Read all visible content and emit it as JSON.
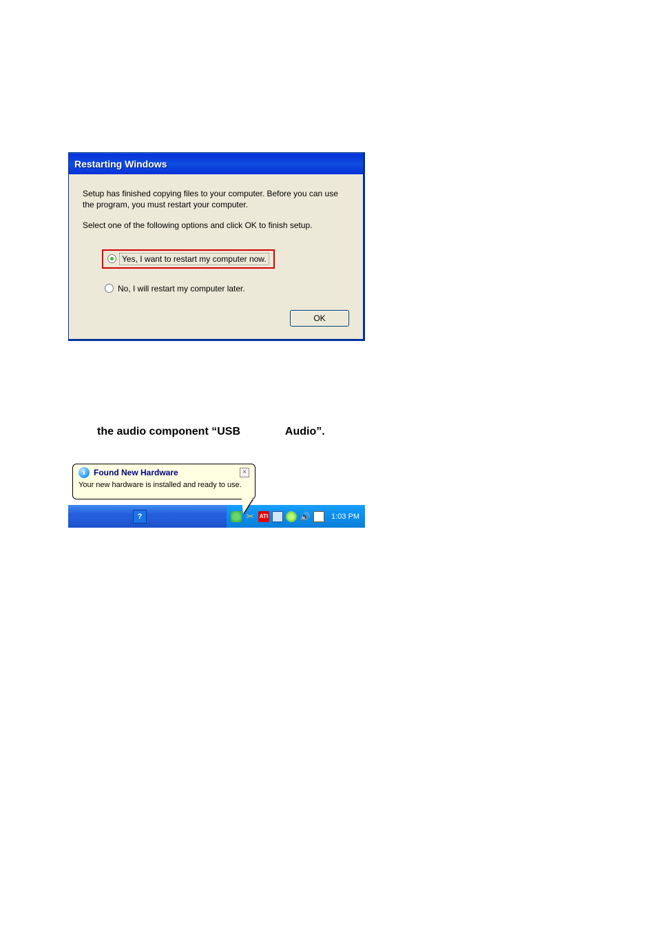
{
  "restart_dialog": {
    "title": "Restarting Windows",
    "para1": "Setup has finished copying files to your computer.  Before you can use the program, you must restart your computer.",
    "para2": "Select one of the following options and click OK to finish setup.",
    "option_yes": "Yes, I want to restart my computer now.",
    "option_no": "No, I will restart my computer later.",
    "ok_label": "OK"
  },
  "instruction": {
    "seg1": "the audio component “USB",
    "seg2": "Audio”."
  },
  "balloon": {
    "title": "Found New Hardware",
    "body": "Your new hardware is installed and ready to use.",
    "info_glyph": "i",
    "close_glyph": "×"
  },
  "taskbar": {
    "lang_indicator": "?",
    "ati_label": "ATI",
    "clock": "1:03 PM"
  }
}
